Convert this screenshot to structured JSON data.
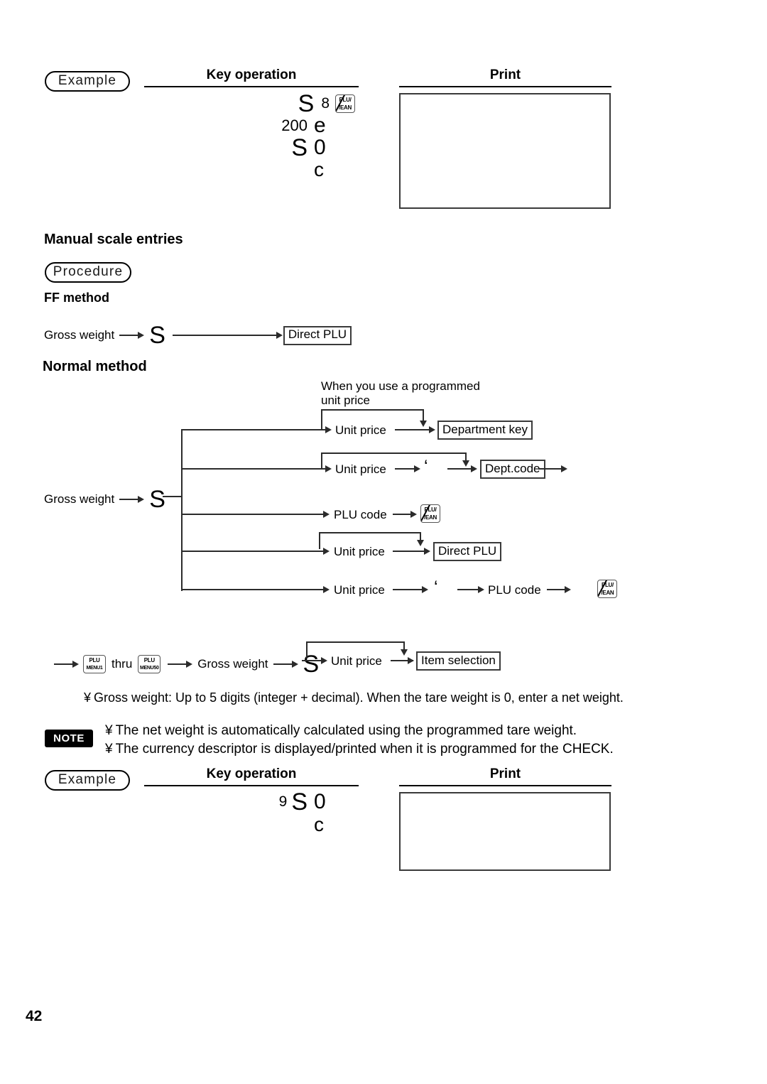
{
  "page": {
    "number": "42"
  },
  "example_top": {
    "tag": "Example",
    "key_operation_header": "Key operation",
    "print_header": "Print",
    "key_operation_lines": [
      {
        "weight": "S",
        "digit": "8",
        "key": "plu-ean-key"
      },
      {
        "amount": "200",
        "char": "e"
      },
      {
        "weight": "S",
        "char": "0"
      },
      {
        "char": "c"
      }
    ],
    "print_content": ""
  },
  "section": {
    "title": "Manual scale entries",
    "procedure_tag": "Procedure"
  },
  "ff_method": {
    "title": "FF method",
    "start_label": "Gross weight",
    "scale_glyph": "S",
    "end_node": "Direct PLU"
  },
  "normal_method": {
    "title": "Normal method",
    "annotation": "When you use a programmed\nunit price",
    "annotation_line1": "When you use a programmed",
    "annotation_line2": "unit price",
    "start_label": "Gross weight",
    "scale_glyph": "S",
    "branches": [
      {
        "step_label": "Unit price",
        "end_node": "Department key",
        "has_bypass": true,
        "boxed_end": true
      },
      {
        "step_label": "Unit price",
        "separator": "‘",
        "end_node": "Dept.code",
        "has_bypass": true,
        "boxed_end": true,
        "trailing_arrow": true
      },
      {
        "step_label": "PLU code",
        "end_key": "plu-ean-key",
        "has_bypass": false,
        "boxed_end": false
      },
      {
        "step_label": "Unit price",
        "end_node": "Direct PLU",
        "has_bypass": true,
        "boxed_end": true
      },
      {
        "step_label": "Unit price",
        "separator": "‘",
        "second_label": "PLU code",
        "end_key": "plu-ean-key",
        "has_bypass": false,
        "boxed_end": false
      }
    ]
  },
  "menu_flow": {
    "key_from_top": "PLU",
    "key_from_bottom": "MENU1",
    "thru_label": "thru",
    "key_to_top": "PLU",
    "key_to_bottom": "MENU50",
    "gross_weight_label": "Gross weight",
    "scale_glyph": "S",
    "unit_price_label": "Unit price",
    "end_node": "Item selection"
  },
  "footnote": {
    "bullet": "¥",
    "text": "Gross weight: Up to 5 digits (integer + decimal). When the tare weight is 0, enter a net weight."
  },
  "note": {
    "badge": "NOTE",
    "bullet": "¥",
    "lines": [
      "The net weight is automatically calculated using the programmed tare weight.",
      "The currency descriptor is displayed/printed when it is programmed for the CHECK."
    ]
  },
  "example_bottom": {
    "tag": "Example",
    "key_operation_header": "Key operation",
    "print_header": "Print",
    "key_operation_lines": [
      {
        "digit": "9",
        "weight": "S",
        "char": "0"
      },
      {
        "char": "c"
      }
    ],
    "print_content": ""
  },
  "keycaps": {
    "plu_ean_top": "PLU/",
    "plu_ean_bottom": "/EAN"
  },
  "colors": {
    "ink": "#000000",
    "line": "#2b2b2b",
    "box_border": "#3a3a3a"
  }
}
